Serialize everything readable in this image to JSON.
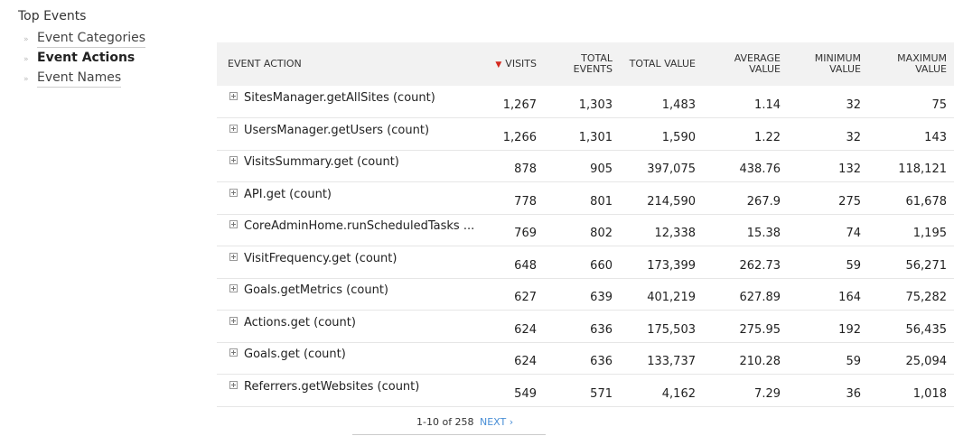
{
  "sidebar": {
    "title": "Top Events",
    "items": [
      {
        "label": "Event Categories"
      },
      {
        "label": "Event Actions"
      },
      {
        "label": "Event Names"
      }
    ]
  },
  "table": {
    "columns": [
      "EVENT ACTION",
      "VISITS",
      "TOTAL EVENTS",
      "TOTAL VALUE",
      "AVERAGE VALUE",
      "MINIMUM VALUE",
      "MAXIMUM VALUE"
    ],
    "sorted_column": "VISITS",
    "sort_direction": "desc",
    "rows": [
      {
        "label": "SitesManager.getAllSites (count)",
        "visits": "1,267",
        "total_events": "1,303",
        "total_value": "1,483",
        "avg": "1.14",
        "min": "32",
        "max": "75"
      },
      {
        "label": "UsersManager.getUsers (count)",
        "visits": "1,266",
        "total_events": "1,301",
        "total_value": "1,590",
        "avg": "1.22",
        "min": "32",
        "max": "143"
      },
      {
        "label": "VisitsSummary.get (count)",
        "visits": "878",
        "total_events": "905",
        "total_value": "397,075",
        "avg": "438.76",
        "min": "132",
        "max": "118,121"
      },
      {
        "label": "API.get (count)",
        "visits": "778",
        "total_events": "801",
        "total_value": "214,590",
        "avg": "267.9",
        "min": "275",
        "max": "61,678"
      },
      {
        "label": "CoreAdminHome.runScheduledTasks ...",
        "visits": "769",
        "total_events": "802",
        "total_value": "12,338",
        "avg": "15.38",
        "min": "74",
        "max": "1,195"
      },
      {
        "label": "VisitFrequency.get (count)",
        "visits": "648",
        "total_events": "660",
        "total_value": "173,399",
        "avg": "262.73",
        "min": "59",
        "max": "56,271"
      },
      {
        "label": "Goals.getMetrics (count)",
        "visits": "627",
        "total_events": "639",
        "total_value": "401,219",
        "avg": "627.89",
        "min": "164",
        "max": "75,282"
      },
      {
        "label": "Actions.get (count)",
        "visits": "624",
        "total_events": "636",
        "total_value": "175,503",
        "avg": "275.95",
        "min": "192",
        "max": "56,435"
      },
      {
        "label": "Goals.get (count)",
        "visits": "624",
        "total_events": "636",
        "total_value": "133,737",
        "avg": "210.28",
        "min": "59",
        "max": "25,094"
      },
      {
        "label": "Referrers.getWebsites (count)",
        "visits": "549",
        "total_events": "571",
        "total_value": "4,162",
        "avg": "7.29",
        "min": "36",
        "max": "1,018"
      }
    ]
  },
  "pagination": {
    "range": "1-10 of 258",
    "next": "Next ›"
  },
  "colors": {
    "header_bg": "#f2f2f2",
    "sort_arrow": "#d4291f",
    "link": "#4a8fd6"
  }
}
